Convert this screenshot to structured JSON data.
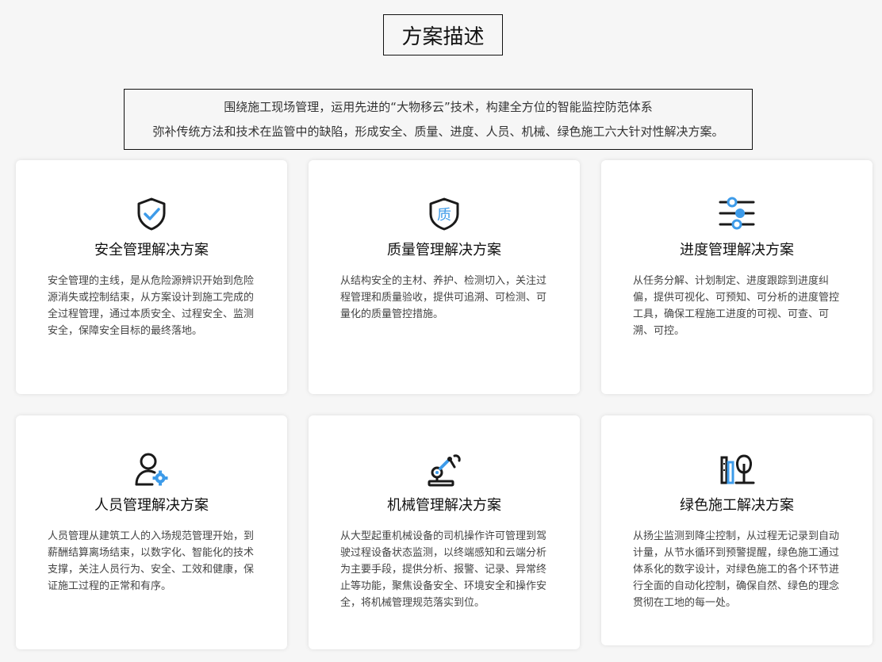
{
  "header": {
    "title": "方案描述"
  },
  "intro": {
    "line1": "围绕施工现场管理，运用先进的“大物移云”技术，构建全方位的智能监控防范体系",
    "line2": "弥补传统方法和技术在监管中的缺陷，形成安全、质量、进度、人员、机械、绿色施工六大针对性解决方案。"
  },
  "colors": {
    "accent_blue": "#3d9be9",
    "icon_dark": "#1a1a1a",
    "background": "#f6f6f6",
    "card_background": "#ffffff"
  },
  "cards": [
    {
      "icon": "shield-check-icon",
      "title": "安全管理解决方案",
      "desc": "安全管理的主线，是从危险源辨识开始到危险源消失或控制结束，从方案设计到施工完成的全过程管理，通过本质安全、过程安全、监测安全，保障安全目标的最终落地。"
    },
    {
      "icon": "quality-badge-icon",
      "icon_text": "质",
      "title": "质量管理解决方案",
      "desc": "从结构安全的主材、养护、检测切入，关注过程管理和质量验收，提供可追溯、可检测、可量化的质量管控措施。"
    },
    {
      "icon": "sliders-icon",
      "title": "进度管理解决方案",
      "desc": "从任务分解、计划制定、进度跟踪到进度纠偏，提供可视化、可预知、可分析的进度管控工具，确保工程施工进度的可视、可查、可溯、可控。"
    },
    {
      "icon": "user-gear-icon",
      "title": "人员管理解决方案",
      "desc": "人员管理从建筑工人的入场规范管理开始，到薪酬结算离场结束，以数字化、智能化的技术支撑，关注人员行为、安全、工效和健康，保证施工过程的正常和有序。"
    },
    {
      "icon": "robot-arm-icon",
      "title": "机械管理解决方案",
      "desc": "从大型起重机械设备的司机操作许可管理到驾驶过程设备状态监测，以终端感知和云端分析为主要手段，提供分析、报警、记录、异常终止等功能，聚焦设备安全、环境安全和操作安全，将机械管理规范落实到位。"
    },
    {
      "icon": "green-building-icon",
      "title": "绿色施工解决方案",
      "desc": "从扬尘监测到降尘控制，从过程无记录到自动计量，从节水循环到预警提醒，绿色施工通过体系化的数字设计，对绿色施工的各个环节进行全面的自动化控制，确保自然、绿色的理念贯彻在工地的每一处。"
    }
  ]
}
